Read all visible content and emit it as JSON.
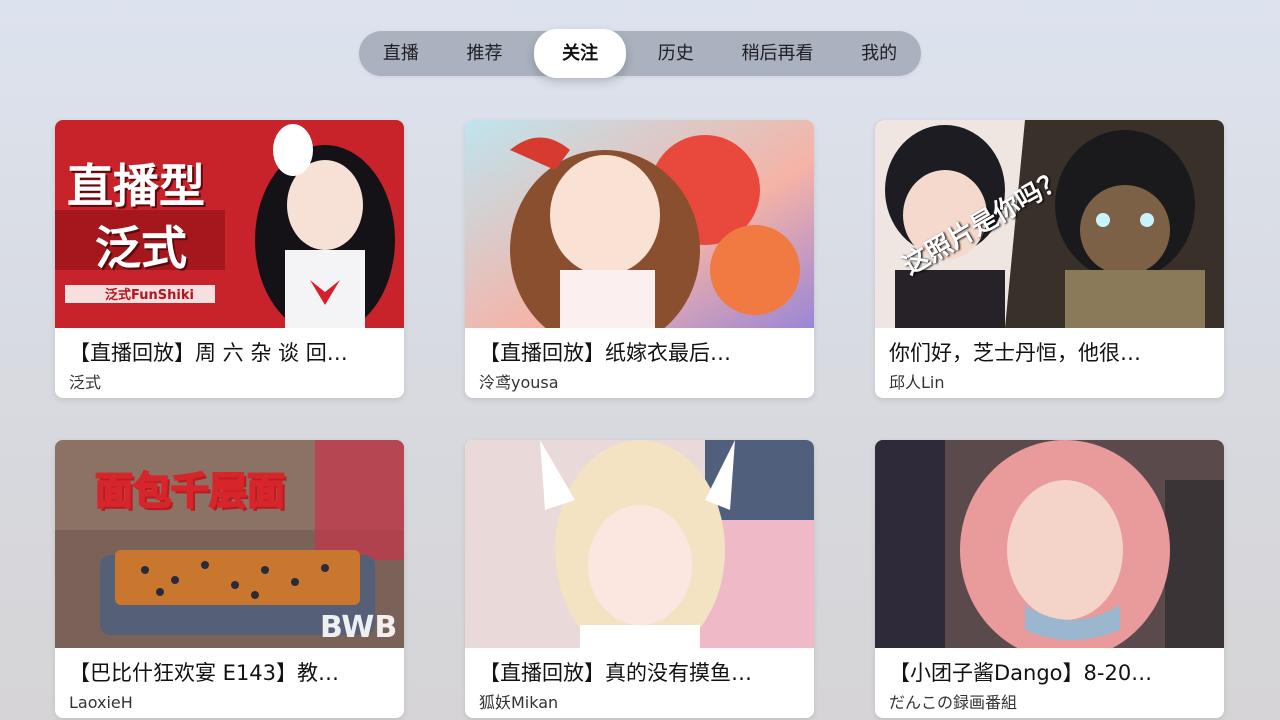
{
  "tabs": [
    {
      "label": "直播",
      "active": false
    },
    {
      "label": "推荐",
      "active": false
    },
    {
      "label": "关注",
      "active": true
    },
    {
      "label": "历史",
      "active": false
    },
    {
      "label": "稍后再看",
      "active": false
    },
    {
      "label": "我的",
      "active": false
    }
  ],
  "videos": [
    {
      "title": "【直播回放】周 六 杂 谈 回…",
      "author": "泛式",
      "thumb": {
        "big_text": "直播型",
        "big_text2": "泛式",
        "tag": "泛式FunShiki",
        "bg": "#c8222a"
      }
    },
    {
      "title": "【直播回放】纸嫁衣最后…",
      "author": "泠鸢yousa",
      "thumb": {
        "bg": "#f1a9a0"
      }
    },
    {
      "title": "你们好，芝士丹恒，他很…",
      "author": "邱人Lin",
      "thumb": {
        "caption": "这照片是你吗？",
        "bg": "#3a302a"
      }
    },
    {
      "title": "【巴比什狂欢宴 E143】教…",
      "author": "LaoxieH",
      "thumb": {
        "big_text": "面包千层面",
        "watermark": "BWB",
        "bg": "#7a6258"
      }
    },
    {
      "title": "【直播回放】真的没有摸鱼…",
      "author": "狐妖Mikan",
      "thumb": {
        "bg": "#e9d9d8"
      }
    },
    {
      "title": "【小团子酱Dango】8-20…",
      "author": "だんこの録画番組",
      "thumb": {
        "bg": "#5a4a4c"
      }
    }
  ]
}
